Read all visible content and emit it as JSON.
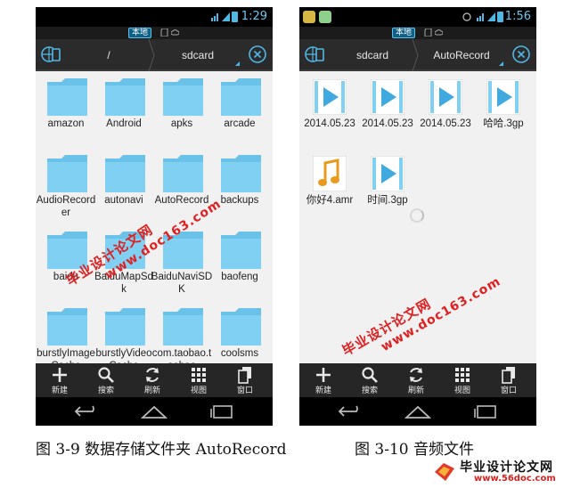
{
  "left_screen": {
    "status_time": "1:29",
    "storage_label": "本地",
    "breadcrumbs": [
      "/",
      "sdcard"
    ],
    "folders": [
      "amazon",
      "Android",
      "apks",
      "arcade",
      "AudioRecorder",
      "autonavi",
      "AutoRecord",
      "backups",
      "baidu",
      "BaiduMapSdk",
      "BaiduNaviSDK",
      "baofeng",
      "burstlyImageCache",
      "burstlyVideoCache",
      "com.taobao.taobao",
      "coolsms"
    ],
    "toolbar_items": [
      "新建",
      "搜索",
      "刷新",
      "视图",
      "窗口"
    ],
    "caption": "图 3-9  数据存储文件夹 AutoRecord"
  },
  "right_screen": {
    "status_time": "1:56",
    "storage_label": "本地",
    "breadcrumbs": [
      "sdcard",
      "AutoRecord"
    ],
    "files": [
      {
        "name": "2014.05.23",
        "icon": "video-file-icon"
      },
      {
        "name": "2014.05.23",
        "icon": "video-file-icon"
      },
      {
        "name": "2014.05.23",
        "icon": "video-file-icon"
      },
      {
        "name": "哈哈.3gp",
        "icon": "video-file-icon"
      },
      {
        "name": "你好4.amr",
        "icon": "audio-file-icon"
      },
      {
        "name": "时间.3gp",
        "icon": "video-file-icon"
      }
    ],
    "toolbar_items": [
      "新建",
      "搜索",
      "刷新",
      "视图",
      "窗口"
    ],
    "caption": "图 3-10  音频文件"
  },
  "watermarks": {
    "line1": "毕业设计论文网",
    "line2": "www.doc163.com"
  },
  "site_logo": {
    "title": "毕业设计论文网",
    "url": "www.56doc.com"
  },
  "colors": {
    "folder": "#7fd0f2",
    "folder_tab": "#6bc2e8",
    "accent": "#4fb8e6",
    "watermark": "#e02020",
    "bar_bg": "#262626"
  }
}
